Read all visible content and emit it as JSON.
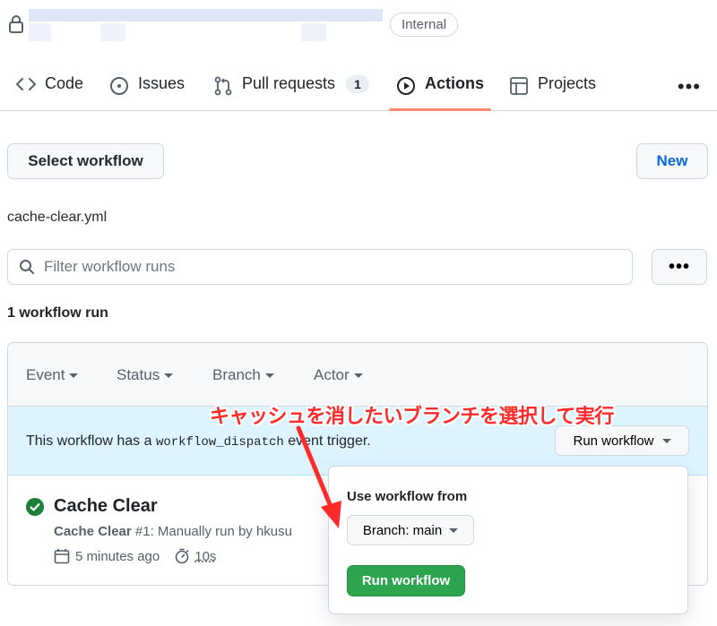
{
  "repo": {
    "visibility_badge": "Internal"
  },
  "nav": {
    "tabs": [
      {
        "label": "Code",
        "icon": "code-icon"
      },
      {
        "label": "Issues",
        "icon": "issue-icon"
      },
      {
        "label": "Pull requests",
        "icon": "pull-request-icon",
        "count": "1"
      },
      {
        "label": "Actions",
        "icon": "play-icon",
        "active": true
      },
      {
        "label": "Projects",
        "icon": "table-icon"
      }
    ],
    "more": "•••"
  },
  "toolbar": {
    "select_workflow": "Select workflow",
    "new": "New"
  },
  "workflow": {
    "filename": "cache-clear.yml"
  },
  "search": {
    "placeholder": "Filter workflow runs",
    "more": "•••"
  },
  "runs": {
    "count_label": "1 workflow run",
    "filters": [
      "Event",
      "Status",
      "Branch",
      "Actor"
    ],
    "dispatch": {
      "prefix": "This workflow has a",
      "code": "workflow_dispatch",
      "suffix": "event trigger.",
      "button": "Run workflow"
    },
    "items": [
      {
        "title": "Cache Clear",
        "workflow": "Cache Clear",
        "run_number": "#1",
        "trigger": ": Manually run by hkusu",
        "time": "5 minutes ago",
        "duration": "10s",
        "status": "success"
      }
    ]
  },
  "popover": {
    "label": "Use workflow from",
    "branch_button": "Branch: main",
    "run_button": "Run workflow"
  },
  "annotation": {
    "text": "キャッシュを消したいブランチを選択して実行",
    "color": "#ff2a2a"
  },
  "colors": {
    "accent": "#fd8c73",
    "success": "#1a7f37",
    "link": "#0969da",
    "primary_button": "#2da44e"
  }
}
